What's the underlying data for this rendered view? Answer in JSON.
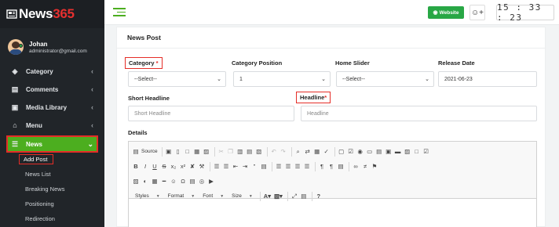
{
  "brand": {
    "name_main": "News",
    "name_accent": "365",
    "icon": "newspaper-icon"
  },
  "user": {
    "name": "Johan",
    "email": "administrator@gmail.com",
    "status_color": "#28a745"
  },
  "sidebar": {
    "items": [
      {
        "label": "Category",
        "icon": "tag-icon"
      },
      {
        "label": "Comments",
        "icon": "comments-icon"
      },
      {
        "label": "Media Library",
        "icon": "media-icon"
      },
      {
        "label": "Menu",
        "icon": "bank-icon"
      },
      {
        "label": "News",
        "icon": "list-icon"
      }
    ],
    "news_sub": [
      "Add Post",
      "News List",
      "Breaking News",
      "Positioning",
      "Redirection"
    ]
  },
  "topbar": {
    "website_label": "Website",
    "clock": "15 : 33 : 23"
  },
  "colors": {
    "accent": "#4cae1f",
    "highlight": "#e52d27",
    "sidebar_bg": "#212529"
  },
  "form": {
    "title": "News Post",
    "category": {
      "label": "Category",
      "required": "*",
      "value": "--Select--"
    },
    "category_position": {
      "label": "Category Position",
      "value": "1"
    },
    "home_slider": {
      "label": "Home Slider",
      "value": "--Select--"
    },
    "release_date": {
      "label": "Release Date",
      "value": "2021-06-23"
    },
    "short_headline": {
      "label": "Short Headline",
      "placeholder": "Short Headline"
    },
    "headline": {
      "label": "Headline",
      "required": "*",
      "placeholder": "Headline"
    },
    "details": {
      "label": "Details"
    }
  },
  "editor": {
    "source_label": "Source",
    "combos": [
      "Styles",
      "Format",
      "Font",
      "Size"
    ]
  }
}
